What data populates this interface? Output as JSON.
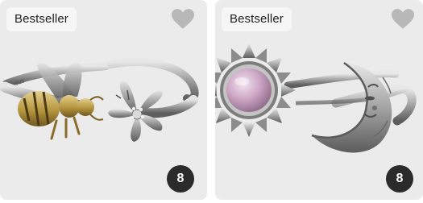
{
  "products": [
    {
      "badge": "Bestseller",
      "count": "8",
      "image_icon": "bee-and-flower-ring-icon",
      "favorite_icon": "heart-icon"
    },
    {
      "badge": "Bestseller",
      "count": "8",
      "image_icon": "sun-and-moon-ring-icon",
      "favorite_icon": "heart-icon"
    }
  ],
  "colors": {
    "card_background": "#ebebeb",
    "badge_background": "#f6f6f6",
    "count_badge": "#2b2b2b",
    "heart": "#b8b8b8",
    "silver": "#b9b9b9",
    "gold": "#b89a52",
    "stone": "#c9a6c4"
  }
}
